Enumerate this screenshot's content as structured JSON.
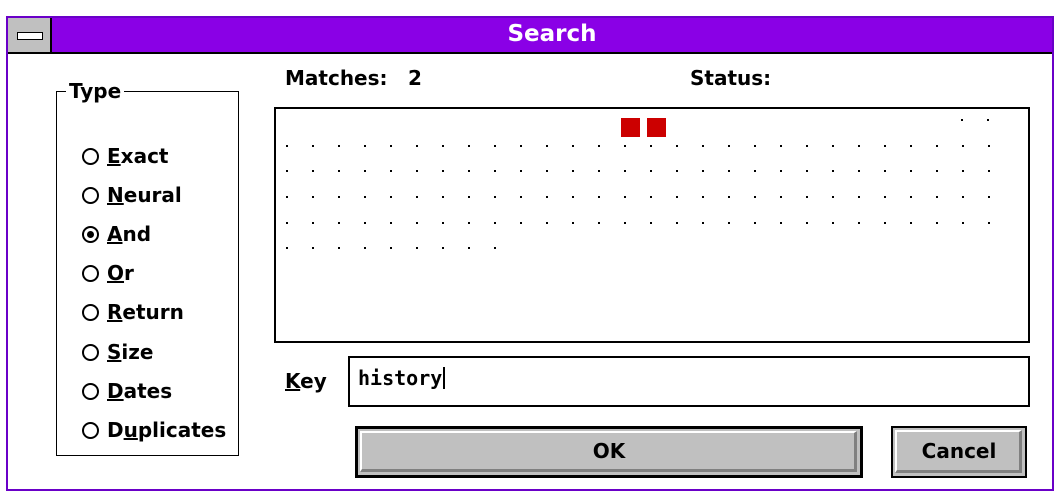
{
  "window": {
    "title": "Search"
  },
  "header": {
    "matches_label": "Matches:",
    "matches_value": "2",
    "status_label": "Status:",
    "status_value": ""
  },
  "type_group": {
    "title": "Type",
    "options": [
      {
        "label": "Exact",
        "hotkey": "E",
        "rest": "xact",
        "selected": false
      },
      {
        "label": "Neural",
        "hotkey": "N",
        "rest": "eural",
        "selected": false
      },
      {
        "label": "And",
        "hotkey": "A",
        "rest": "nd",
        "selected": true
      },
      {
        "label": "Or",
        "hotkey": "O",
        "rest": "r",
        "selected": false
      },
      {
        "label": "Return",
        "hotkey": "R",
        "rest": "eturn",
        "selected": false
      },
      {
        "label": "Size",
        "hotkey": "S",
        "rest": "ize",
        "selected": false
      },
      {
        "label": "Dates",
        "hotkey": "D",
        "rest": "ates",
        "selected": false
      },
      {
        "label": "Duplicates",
        "hotkey": "u",
        "pre": "D",
        "rest": "plicates",
        "selected": false
      }
    ]
  },
  "results": {
    "match_color": "#cc0000",
    "dot_color": "#000000",
    "match_count": 2
  },
  "key": {
    "label_hotkey": "K",
    "label_rest": "ey",
    "value": "history"
  },
  "buttons": {
    "ok_label": "OK",
    "cancel_label": "Cancel"
  },
  "colors": {
    "titlebar": "#8a00e6",
    "button_face": "#c0c0c0"
  }
}
